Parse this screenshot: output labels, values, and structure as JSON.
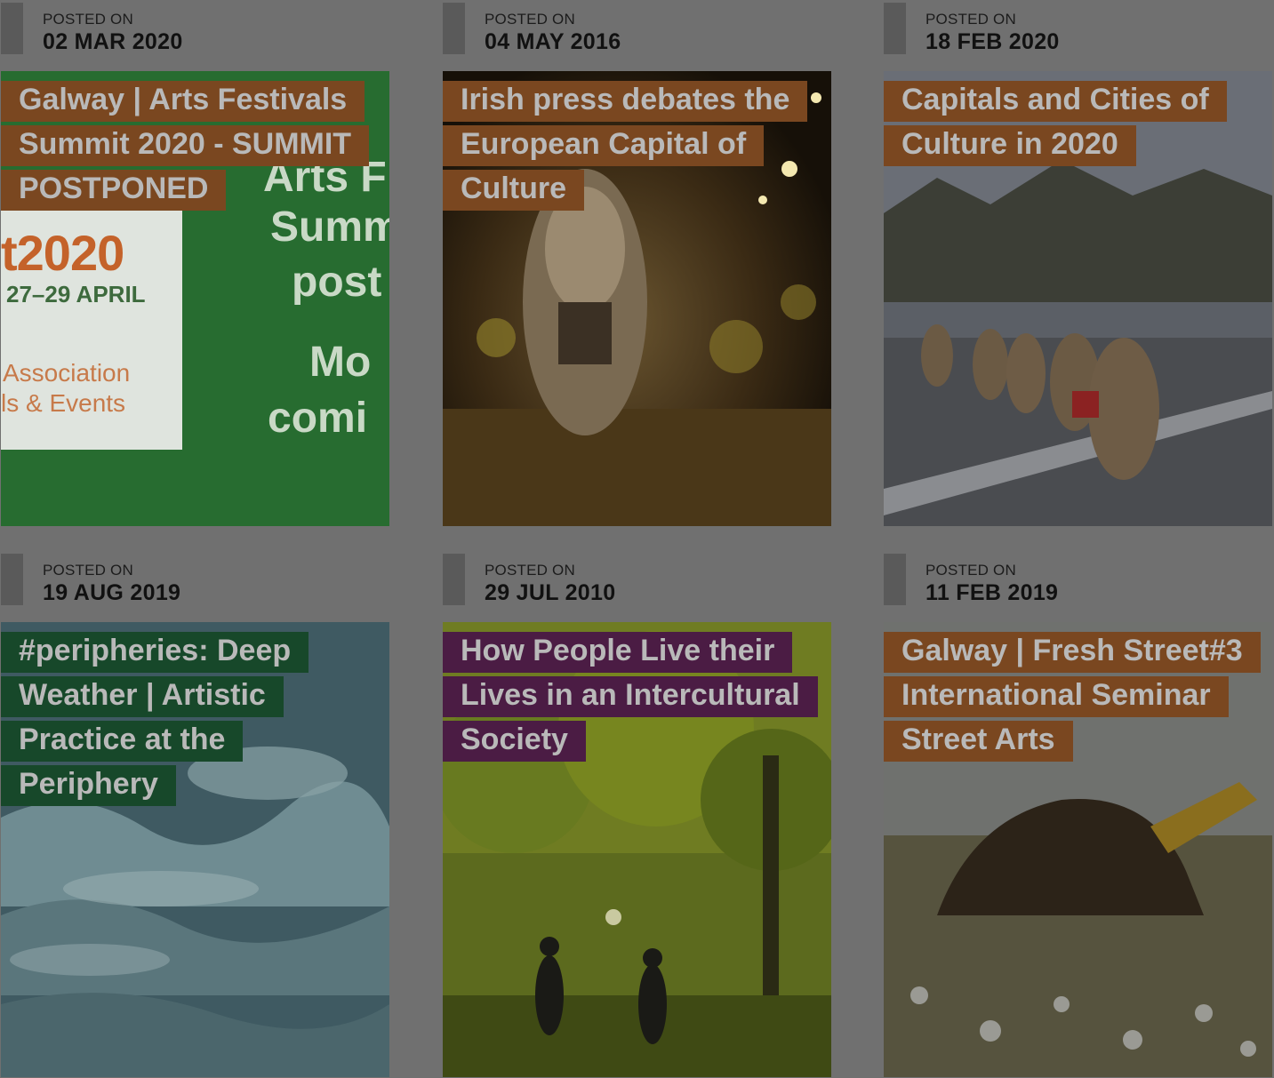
{
  "colors": {
    "page_background": "#707070",
    "title_orange": "#7a4720",
    "title_purple": "#4b1c44",
    "title_green": "#17482a",
    "title_text": "#b9b9b9"
  },
  "posted_on_label": "POSTED ON",
  "posts": [
    {
      "date": "02 MAR 2020",
      "title": "Galway | Arts Festivals Summit 2020 - SUMMIT POSTPONED",
      "title_color": "orange",
      "image": "galway-arts-festivals-poster",
      "poster": {
        "year": "t2020",
        "dates": "27–29 APRIL",
        "assoc_line1": "Association",
        "assoc_line2": "ls & Events",
        "right_line1": "Arts F",
        "right_line2": "Summ",
        "right_line3": "post",
        "right_line4": "Mo",
        "right_line5": "comi"
      }
    },
    {
      "date": "04 MAY 2016",
      "title": "Irish press debates the European Capital of Culture",
      "title_color": "orange",
      "image": "night-parade-giant-puppet-photo"
    },
    {
      "date": "18 FEB 2020",
      "title": "Capitals and Cities of Culture in 2020",
      "title_color": "orange",
      "image": "costumed-street-procession-photo"
    },
    {
      "date": "19 AUG 2019",
      "title": "#peripheries: Deep Weather | Artistic Practice at the Periphery",
      "title_color": "green",
      "image": "ocean-waves-photo"
    },
    {
      "date": "29 JUL 2010",
      "title": "How People Live their Lives in an Intercultural Society",
      "title_color": "purple",
      "image": "children-playing-football-park-photo"
    },
    {
      "date": "11 FEB 2019",
      "title": "Galway | Fresh Street#3 International Seminar Street Arts",
      "title_color": "orange",
      "image": "turf-pile-bog-performance-photo"
    }
  ]
}
